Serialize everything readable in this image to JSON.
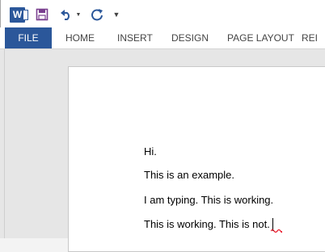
{
  "qat": {
    "app_icon": "word-icon",
    "buttons": [
      "save-icon",
      "undo-icon",
      "undo-dropdown-icon",
      "redo-icon",
      "customize-toolbar-icon"
    ]
  },
  "ribbon": {
    "tabs": [
      "FILE",
      "HOME",
      "INSERT",
      "DESIGN",
      "PAGE LAYOUT",
      "REI"
    ],
    "accent_color": "#2b579a"
  },
  "document": {
    "lines": [
      "Hi.",
      "This is an example.",
      "I am typing. This is working.",
      "This is working. This is not."
    ],
    "spellcheck_color": "#e81123"
  }
}
